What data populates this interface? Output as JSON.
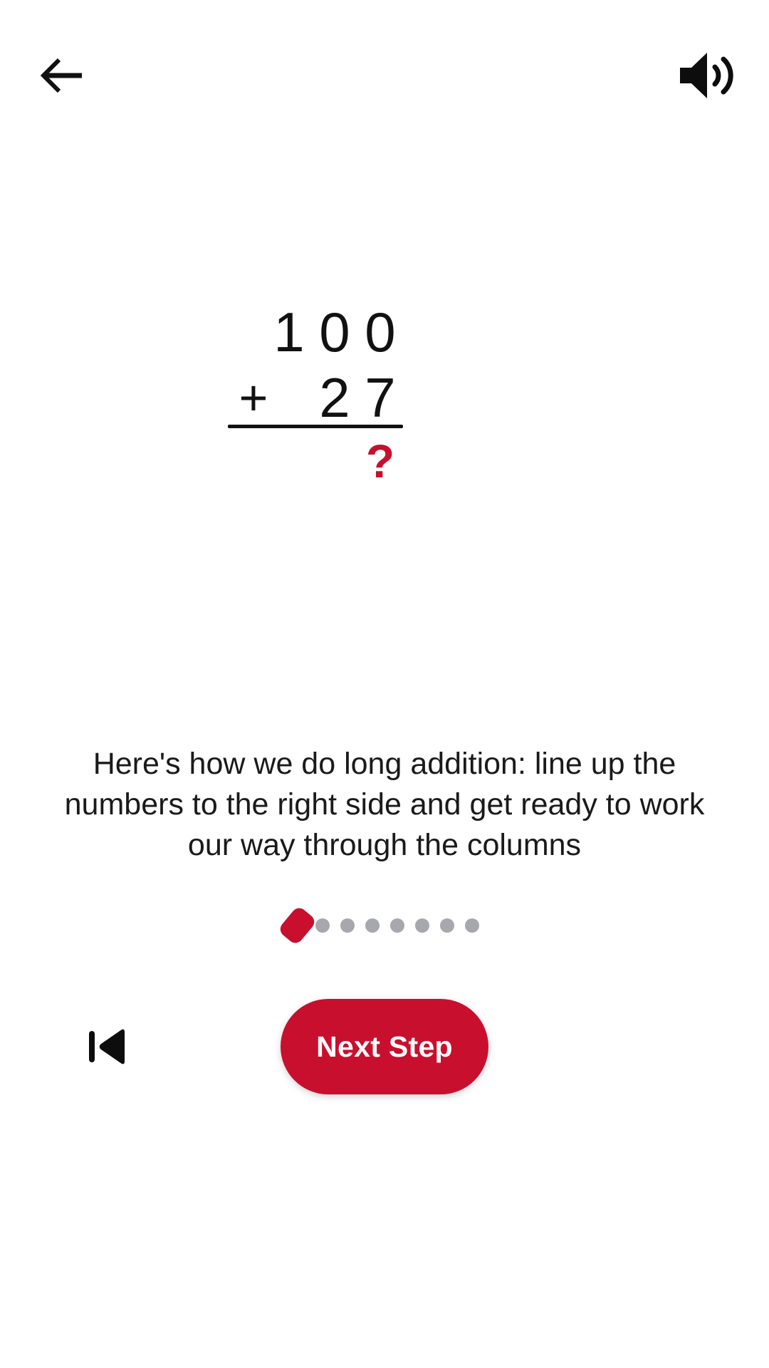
{
  "colors": {
    "accent": "#C8102E",
    "text": "#111111",
    "dot_inactive": "#a6a8ad",
    "background": "#ffffff"
  },
  "header": {
    "back_icon": "back-arrow-icon",
    "sound_icon": "speaker-volume-icon"
  },
  "problem": {
    "operation": "addition",
    "operator": "+",
    "addend_top": "1 0 0",
    "addend_top_digits": [
      "1",
      "0",
      "0"
    ],
    "addend_bottom": "27",
    "addend_bottom_digits": [
      "2",
      "7"
    ],
    "answer_placeholder": "?"
  },
  "instruction": {
    "text": "Here's how we do long addition: line up the numbers to the right side and get ready to work our way through the columns"
  },
  "pagination": {
    "total": 8,
    "active_index": 0,
    "dots": [
      {
        "state": "active"
      },
      {
        "state": "inactive"
      },
      {
        "state": "inactive"
      },
      {
        "state": "inactive"
      },
      {
        "state": "inactive"
      },
      {
        "state": "inactive"
      },
      {
        "state": "inactive"
      },
      {
        "state": "inactive"
      }
    ]
  },
  "footer": {
    "prev_icon": "skip-previous-icon",
    "next_label": "Next Step"
  }
}
